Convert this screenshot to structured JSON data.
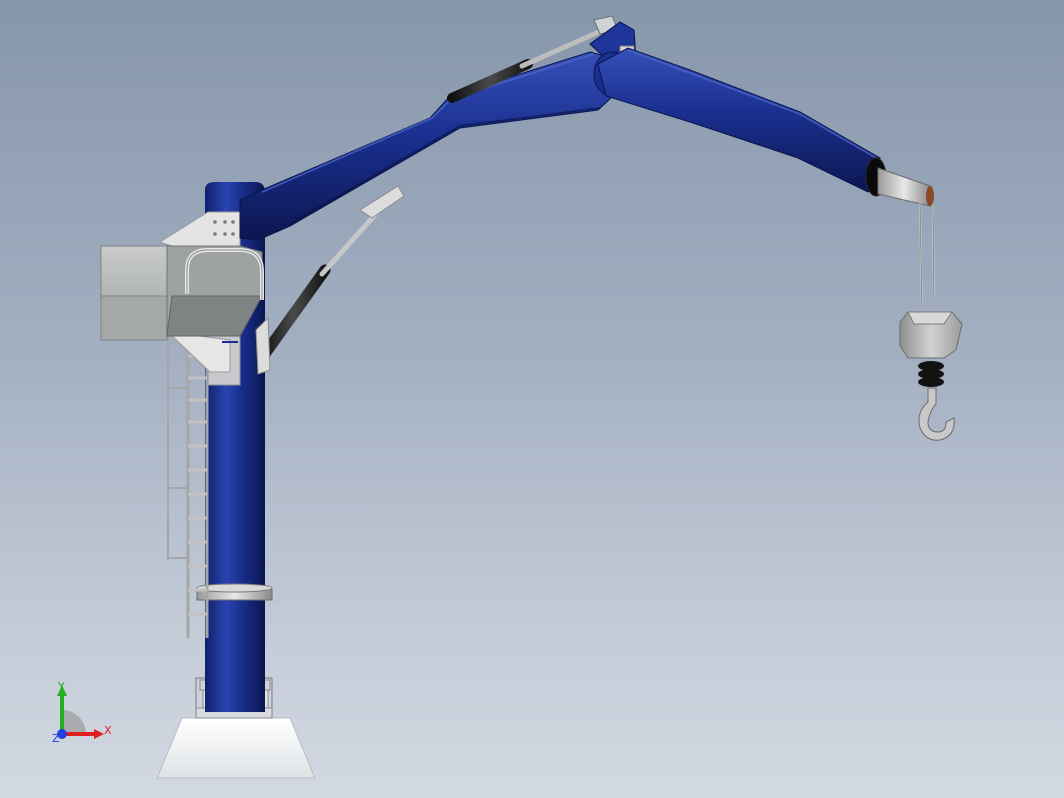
{
  "viewport": {
    "background_top": "#8696ab",
    "background_bottom": "#d3d9e2"
  },
  "model": {
    "type": "crane-3d-model",
    "colors": {
      "boom_blue": "#1a2f8f",
      "boom_blue_dark": "#0f1f6a",
      "boom_blue_light": "#3550b8",
      "steel_light": "#dcdcdc",
      "steel_mid": "#a8a8a8",
      "cylinder_dark": "#2a2a2a",
      "platform_grey": "#b9bbbb"
    }
  },
  "triad": {
    "x_label": "X",
    "y_label": "Y",
    "z_label": "Z",
    "x_color": "#e02020",
    "y_color": "#20b020",
    "z_color": "#2040e0"
  }
}
